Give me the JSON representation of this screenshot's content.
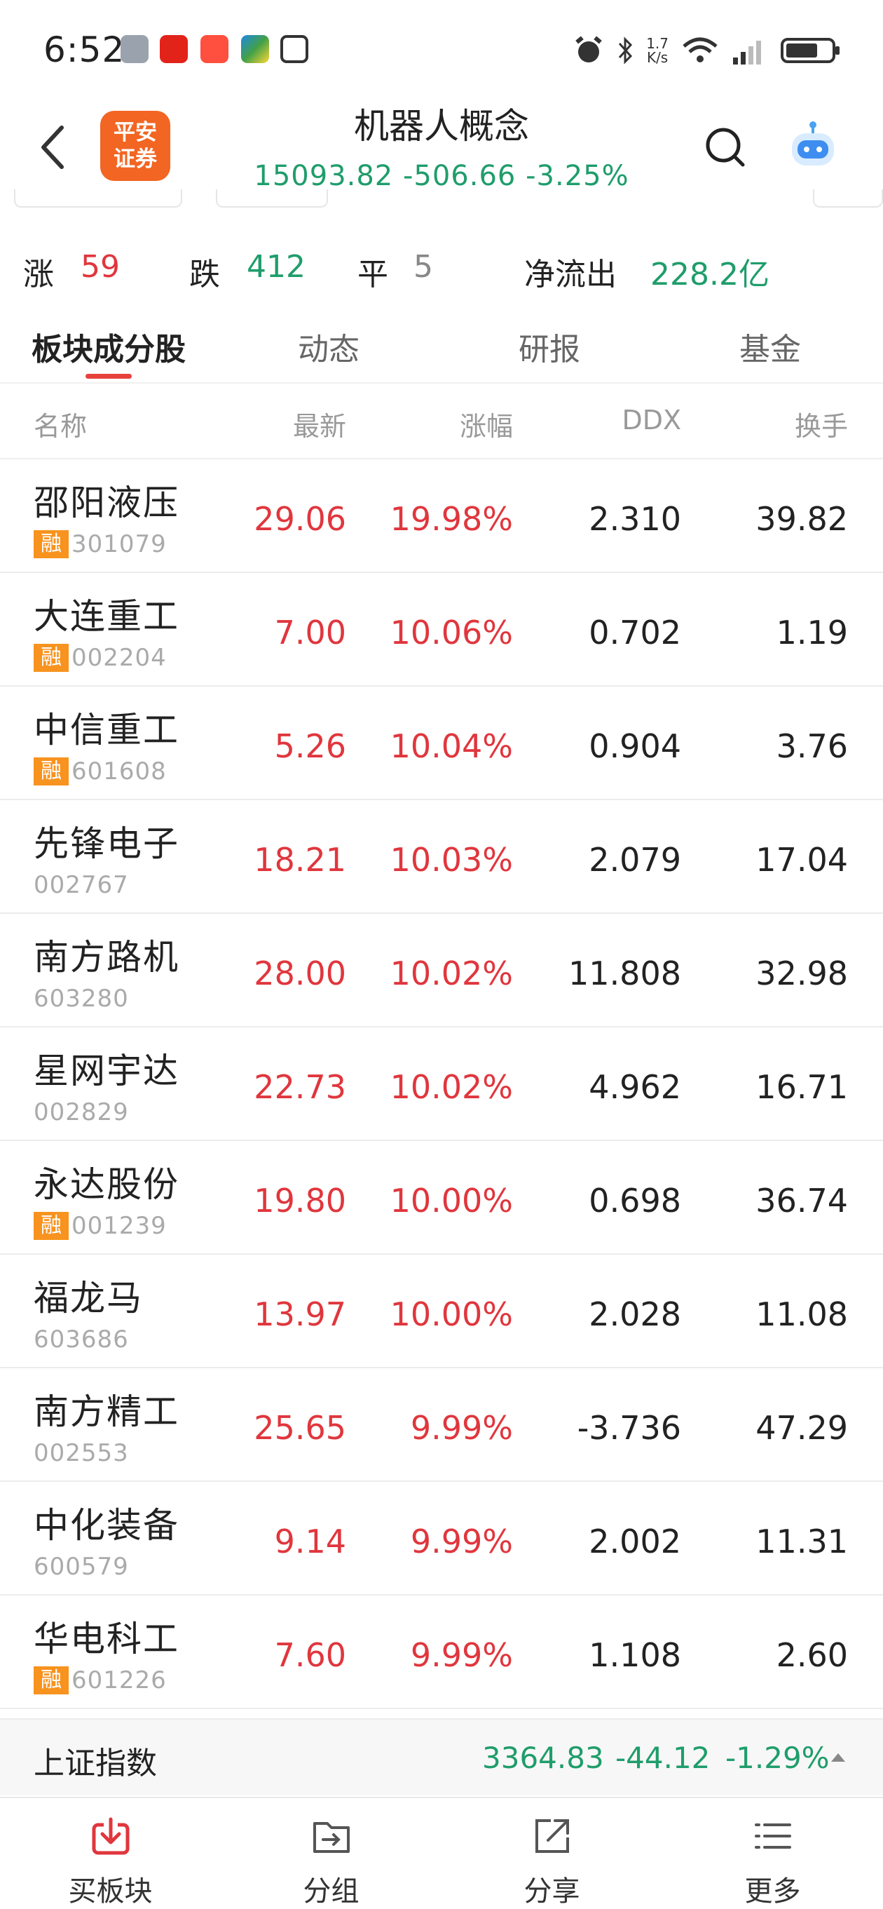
{
  "status_bar": {
    "time": "6:52",
    "net_speed_top": "1.7",
    "net_speed_bottom": "K/s"
  },
  "header": {
    "logo_line1": "平安",
    "logo_line2": "证券",
    "title": "机器人概念",
    "index_value": "15093.82",
    "index_change": "-506.66",
    "index_pct": "-3.25%"
  },
  "stats": {
    "up_label": "涨",
    "up_count": "59",
    "down_label": "跌",
    "down_count": "412",
    "flat_label": "平",
    "flat_count": "5",
    "netflow_label": "净流出",
    "netflow_value": "228.2亿"
  },
  "tabs": [
    "板块成分股",
    "动态",
    "研报",
    "基金"
  ],
  "table": {
    "headers": [
      "名称",
      "最新",
      "涨幅",
      "DDX",
      "换手"
    ],
    "margin_badge": "融",
    "rows": [
      {
        "name": "邵阳液压",
        "code": "301079",
        "margin": true,
        "price": "29.06",
        "pct": "19.98%",
        "ddx": "2.310",
        "turnover": "39.82"
      },
      {
        "name": "大连重工",
        "code": "002204",
        "margin": true,
        "price": "7.00",
        "pct": "10.06%",
        "ddx": "0.702",
        "turnover": "1.19"
      },
      {
        "name": "中信重工",
        "code": "601608",
        "margin": true,
        "price": "5.26",
        "pct": "10.04%",
        "ddx": "0.904",
        "turnover": "3.76"
      },
      {
        "name": "先锋电子",
        "code": "002767",
        "margin": false,
        "price": "18.21",
        "pct": "10.03%",
        "ddx": "2.079",
        "turnover": "17.04"
      },
      {
        "name": "南方路机",
        "code": "603280",
        "margin": false,
        "price": "28.00",
        "pct": "10.02%",
        "ddx": "11.808",
        "turnover": "32.98"
      },
      {
        "name": "星网宇达",
        "code": "002829",
        "margin": false,
        "price": "22.73",
        "pct": "10.02%",
        "ddx": "4.962",
        "turnover": "16.71"
      },
      {
        "name": "永达股份",
        "code": "001239",
        "margin": true,
        "price": "19.80",
        "pct": "10.00%",
        "ddx": "0.698",
        "turnover": "36.74"
      },
      {
        "name": "福龙马",
        "code": "603686",
        "margin": false,
        "price": "13.97",
        "pct": "10.00%",
        "ddx": "2.028",
        "turnover": "11.08"
      },
      {
        "name": "南方精工",
        "code": "002553",
        "margin": false,
        "price": "25.65",
        "pct": "9.99%",
        "ddx": "-3.736",
        "turnover": "47.29"
      },
      {
        "name": "中化装备",
        "code": "600579",
        "margin": false,
        "price": "9.14",
        "pct": "9.99%",
        "ddx": "2.002",
        "turnover": "11.31"
      },
      {
        "name": "华电科工",
        "code": "601226",
        "margin": true,
        "price": "7.60",
        "pct": "9.99%",
        "ddx": "1.108",
        "turnover": "2.60"
      }
    ]
  },
  "index_bar": {
    "name": "上证指数",
    "value": "3364.83",
    "change": "-44.12",
    "pct": "-1.29%"
  },
  "bottom_nav": [
    "买板块",
    "分组",
    "分享",
    "更多"
  ],
  "colors": {
    "up": "#e0363d",
    "down": "#1f9d6b",
    "brand": "#f26522",
    "margin_badge": "#f7931e"
  }
}
